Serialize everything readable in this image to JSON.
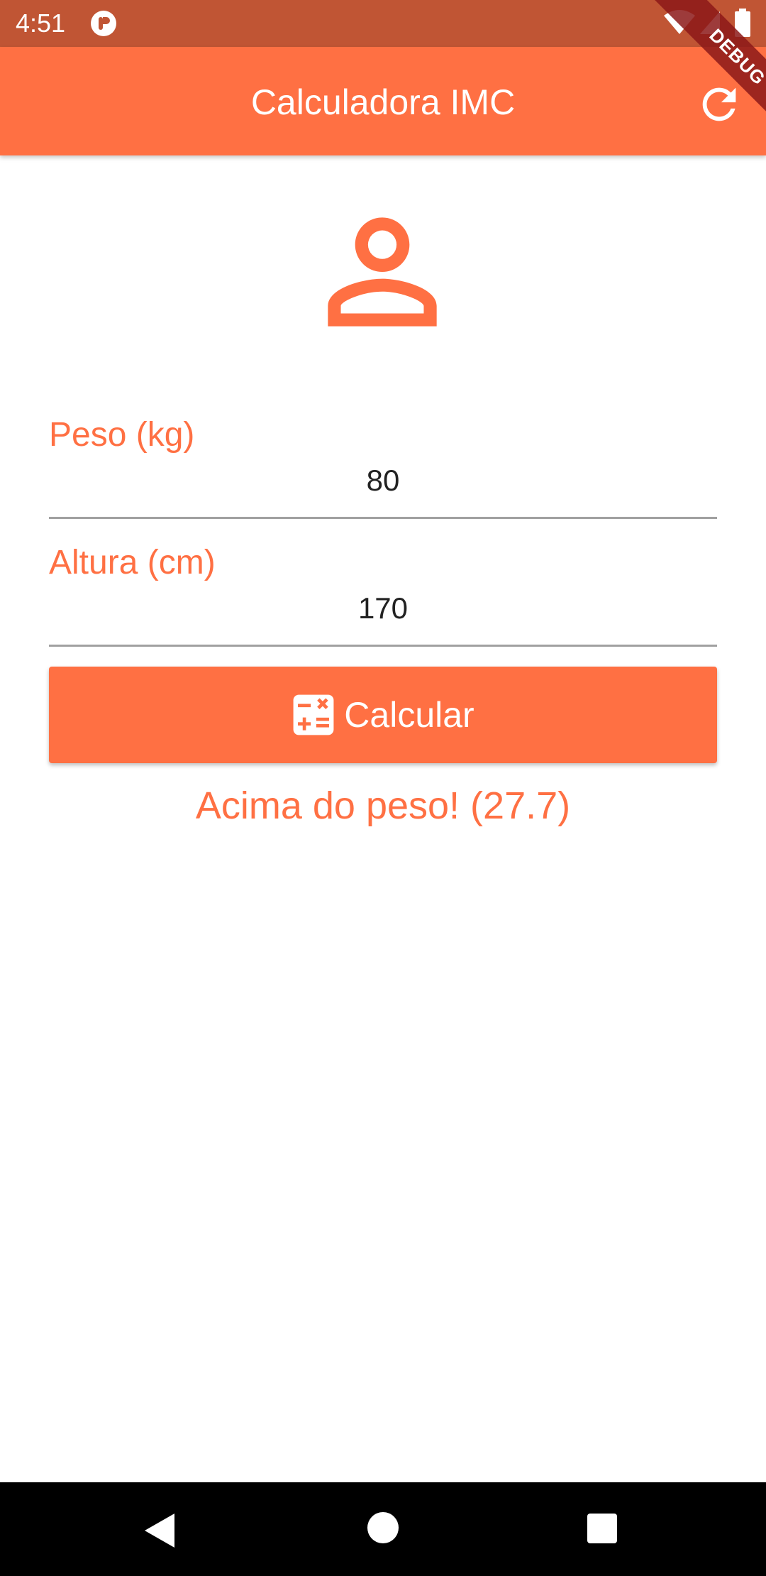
{
  "status_bar": {
    "time": "4:51",
    "app_icon": "app-notification-icon",
    "icons": [
      "wifi-icon",
      "signal-icon",
      "battery-icon"
    ]
  },
  "debug_banner": {
    "label": "DEBUG"
  },
  "app_bar": {
    "title": "Calculadora IMC",
    "refresh_icon": "refresh-icon"
  },
  "form": {
    "avatar_icon": "person-icon",
    "weight": {
      "label": "Peso (kg)",
      "value": "80"
    },
    "height": {
      "label": "Altura (cm)",
      "value": "170"
    },
    "calculate_button": {
      "label": "Calcular",
      "icon": "calculator-icon"
    },
    "result": "Acima do peso! (27.7)"
  },
  "nav_bar": {
    "back_icon": "back-icon",
    "home_icon": "home-icon",
    "recents_icon": "recents-icon"
  },
  "colors": {
    "accent": "#ff7043",
    "status_bar": "#c05534",
    "nav_bar": "#000000",
    "underline": "#a0a0a0"
  }
}
